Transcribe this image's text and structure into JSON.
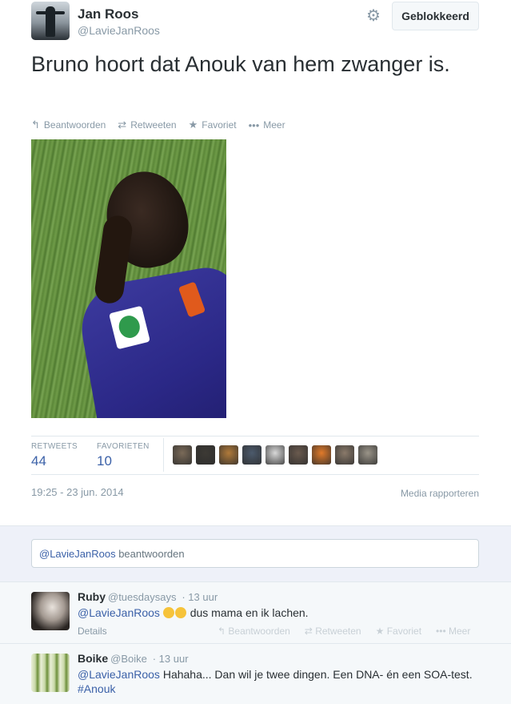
{
  "tweet": {
    "author_name": "Jan Roos",
    "author_handle": "@LavieJanRoos",
    "settings_icon": "gear-icon",
    "blocked_label": "Geblokkeerd",
    "text": "Bruno hoort dat Anouk van hem zwanger is.",
    "actions": [
      {
        "icon": "reply-icon",
        "glyph": "↰",
        "label": "Beantwoorden"
      },
      {
        "icon": "retweet-icon",
        "glyph": "⇄",
        "label": "Retweeten"
      },
      {
        "icon": "star-icon",
        "glyph": "★",
        "label": "Favoriet"
      },
      {
        "icon": "more-icon",
        "glyph": "•••",
        "label": "Meer"
      }
    ],
    "stats": {
      "retweets_label": "RETWEETS",
      "retweets_value": "44",
      "favorites_label": "FAVORIETEN",
      "favorites_value": "10"
    },
    "face_colors": [
      "#7a6a58",
      "#3d3a35",
      "#b07a3a",
      "#4c5a6c",
      "#d8d8d8",
      "#6a5a4e",
      "#e07a2a",
      "#8a7a6a",
      "#9a9488"
    ],
    "timestamp": "19:25 - 23 jun. 2014",
    "report_label": "Media rapporteren"
  },
  "reply_box": {
    "mention": "@LavieJanRoos",
    "text": " beantwoorden"
  },
  "replies": [
    {
      "name": "Ruby",
      "handle": "@tuesdaysays",
      "time": "· 13 uur",
      "mention": "@LavieJanRoos",
      "text": " dus mama en ik lachen.",
      "details": "Details",
      "actions": [
        "Beantwoorden",
        "Retweeten",
        "Favoriet",
        "Meer"
      ]
    },
    {
      "name": "Boike",
      "handle": "@Boike",
      "time": "· 13 uur",
      "mention": "@LavieJanRoos",
      "text": " Hahaha... Dan wil je twee dingen. Een DNA- én een SOA-test.",
      "hashtag": "#Anouk"
    }
  ]
}
